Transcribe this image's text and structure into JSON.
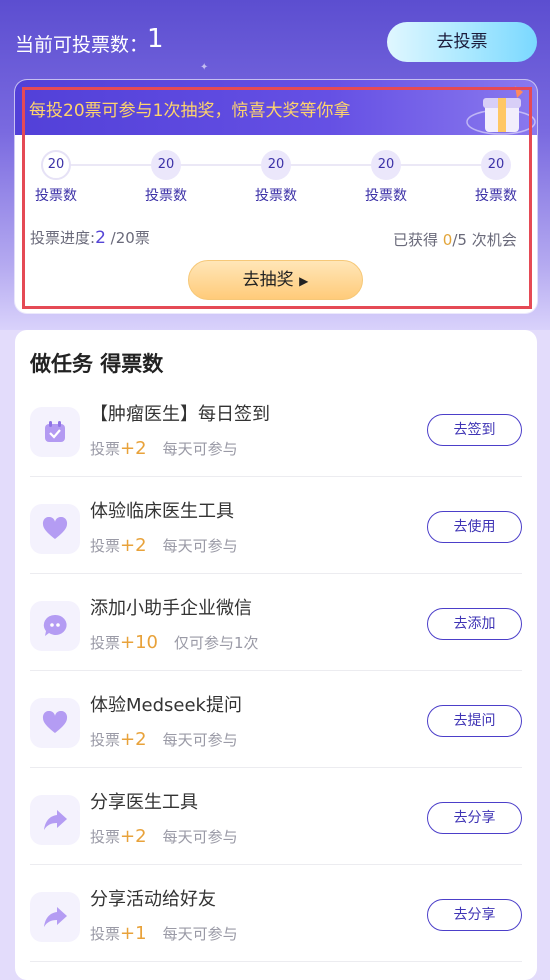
{
  "header": {
    "votes_label": "当前可投票数：",
    "votes_count": "1",
    "vote_button": "去投票"
  },
  "lottery": {
    "banner": "每投20票可参与1次抽奖，惊喜大奖等你拿",
    "milestones": [
      {
        "value": "20",
        "label": "投票数"
      },
      {
        "value": "20",
        "label": "投票数"
      },
      {
        "value": "20",
        "label": "投票数"
      },
      {
        "value": "20",
        "label": "投票数"
      },
      {
        "value": "20",
        "label": "投票数"
      }
    ],
    "progress_label": "投票进度:",
    "progress_current": "2",
    "progress_total": "/20票",
    "chance_prefix": "已获得 ",
    "chance_got": "0",
    "chance_suffix": "/5 次机会",
    "draw_button": "去抽奖",
    "draw_arrow": "▶"
  },
  "tasks": {
    "title": "做任务 得票数",
    "items": [
      {
        "title": "【肿瘤医生】每日签到",
        "vote_label": "投票",
        "plus": "+2",
        "freq": "每天可参与",
        "button": "去签到",
        "icon": "calendar-check-icon"
      },
      {
        "title": "体验临床医生工具",
        "vote_label": "投票",
        "plus": "+2",
        "freq": "每天可参与",
        "button": "去使用",
        "icon": "heart-icon"
      },
      {
        "title": "添加小助手企业微信",
        "vote_label": "投票",
        "plus": "+10",
        "freq": "仅可参与1次",
        "button": "去添加",
        "icon": "chat-bubble-icon"
      },
      {
        "title": "体验Medseek提问",
        "vote_label": "投票",
        "plus": "+2",
        "freq": "每天可参与",
        "button": "去提问",
        "icon": "heart-icon"
      },
      {
        "title": "分享医生工具",
        "vote_label": "投票",
        "plus": "+2",
        "freq": "每天可参与",
        "button": "去分享",
        "icon": "share-arrow-icon"
      },
      {
        "title": "分享活动给好友",
        "vote_label": "投票",
        "plus": "+1",
        "freq": "每天可参与",
        "button": "去分享",
        "icon": "share-arrow-icon"
      }
    ]
  },
  "colors": {
    "accent": "#4c3fc9",
    "highlight": "#e8a23a",
    "banner_text": "#ffd46b"
  }
}
